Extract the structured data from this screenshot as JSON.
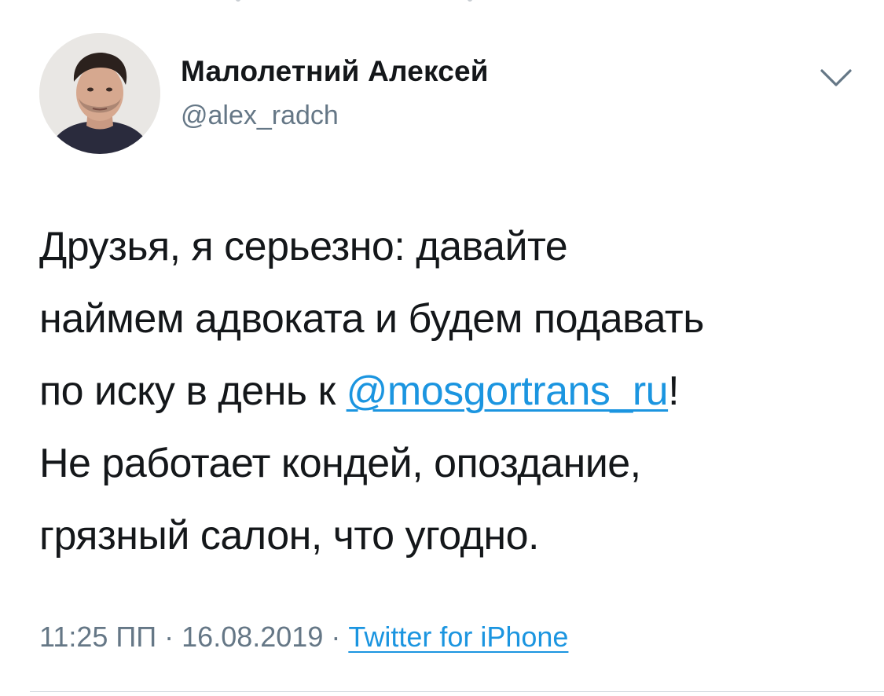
{
  "author": {
    "name": "Малолетний Алексей",
    "handle": "@alex_radch"
  },
  "tweet": {
    "line1": "Друзья, я серьезно: давайте",
    "line2": "наймем адвоката и будем подавать",
    "line3_prefix": "по иску в день к ",
    "mention": "@mosgortrans_ru",
    "line3_suffix": "!",
    "line4": "Не работает кондей, опоздание,",
    "line5": "грязный салон, что угодно."
  },
  "meta": {
    "timestamp": "11:25 ПП · 16.08.2019 · ",
    "source": "Twitter for iPhone"
  },
  "icons": {
    "menu": "chevron-down-icon",
    "avatar": "profile-photo"
  },
  "colors": {
    "link": "#1b95e0",
    "secondary_text": "#657786",
    "primary_text": "#14171a"
  }
}
